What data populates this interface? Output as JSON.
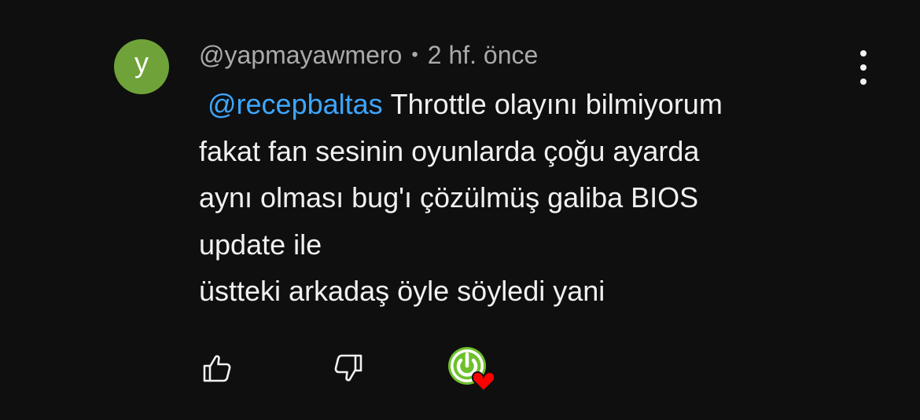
{
  "comment": {
    "avatar_letter": "y",
    "avatar_color": "#6fa339",
    "author": "@yapmayawmero",
    "separator": "•",
    "time_ago": "2 hf. önce",
    "mention": "@recepbaltas",
    "text_line1": "Throttle olayını bilmiyorum",
    "text_line2": "fakat fan sesinin oyunlarda çoğu ayarda",
    "text_line3": "aynı olması bug'ı çözülmüş galiba BIOS",
    "text_line4": "update ile",
    "text_line5": "üstteki arkadaş öyle söyledi yani",
    "mention_color": "#3ea6ff",
    "heart_color": "#ff0000",
    "creator_badge_color": "#6fc02c"
  },
  "actions": {
    "like_icon": "thumbs-up-icon",
    "dislike_icon": "thumbs-down-icon",
    "menu_icon": "more-vertical-icon",
    "creator_heart_icon": "creator-heart-icon"
  }
}
